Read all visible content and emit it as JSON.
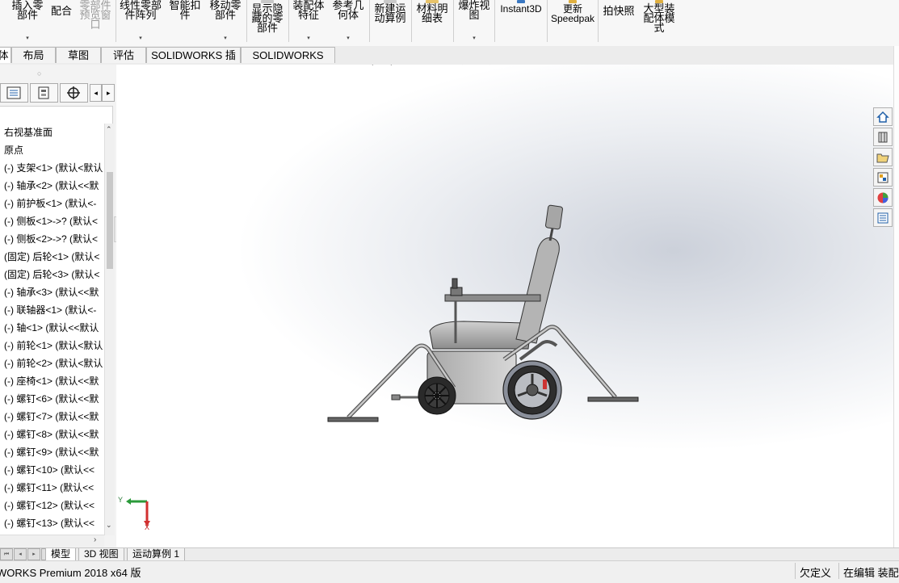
{
  "ribbon": {
    "buttons": [
      {
        "label": "插入零\n部件",
        "dropdown": true,
        "disabled": false
      },
      {
        "label": "配合",
        "dropdown": false,
        "disabled": false
      },
      {
        "label": "零部件\n预览窗\n口",
        "dropdown": false,
        "disabled": true
      },
      {
        "label": "线性零部\n件阵列",
        "dropdown": true,
        "disabled": false
      },
      {
        "label": "智能扣\n件",
        "dropdown": false,
        "disabled": false
      },
      {
        "label": "移动零\n部件",
        "dropdown": true,
        "disabled": false
      },
      {
        "label": "显示隐\n藏的零\n部件",
        "dropdown": false,
        "disabled": false
      },
      {
        "label": "装配体\n特征",
        "dropdown": true,
        "disabled": false
      },
      {
        "label": "参考几\n何体",
        "dropdown": true,
        "disabled": false
      },
      {
        "label": "新建运\n动算例",
        "dropdown": false,
        "disabled": false
      },
      {
        "label": "材料明\n细表",
        "dropdown": false,
        "disabled": false
      },
      {
        "label": "爆炸视\n图",
        "dropdown": true,
        "disabled": false
      },
      {
        "label": "Instant3D",
        "dropdown": false,
        "disabled": false
      },
      {
        "label": "更新\nSpeedpak",
        "dropdown": false,
        "disabled": false
      },
      {
        "label": "拍快照",
        "dropdown": false,
        "disabled": false
      },
      {
        "label": "大型装\n配体模\n式",
        "dropdown": false,
        "disabled": false
      }
    ]
  },
  "command_tabs": [
    {
      "label": "体",
      "active": true
    },
    {
      "label": "布局",
      "active": false
    },
    {
      "label": "草图",
      "active": false
    },
    {
      "label": "评估",
      "active": false
    },
    {
      "label": "SOLIDWORKS 插件",
      "active": false
    },
    {
      "label": "SOLIDWORKS MBD",
      "active": false
    }
  ],
  "feature_tree": {
    "items": [
      "右视基准面",
      "原点",
      "(-) 支架<1> (默认<默认",
      "(-) 轴承<2> (默认<<默",
      "(-) 前护板<1> (默认<-",
      "(-) 侧板<1>->? (默认<",
      "(-) 侧板<2>->? (默认<",
      "(固定) 后轮<1> (默认<",
      "(固定) 后轮<3> (默认<",
      "(-) 轴承<3> (默认<<默",
      "(-) 联轴器<1> (默认<-",
      "(-) 轴<1> (默认<<默认",
      "(-) 前轮<1> (默认<默认",
      "(-) 前轮<2> (默认<默认",
      "(-) 座椅<1> (默认<<默",
      "(-) 螺钉<6> (默认<<默",
      "(-) 螺钉<7> (默认<<默",
      "(-) 螺钉<8> (默认<<默",
      "(-) 螺钉<9> (默认<<默",
      "(-) 螺钉<10> (默认<<",
      "(-) 螺钉<11> (默认<<",
      "(-) 螺钉<12> (默认<<",
      "(-) 螺钉<13> (默认<<"
    ]
  },
  "triad": {
    "y_label": "Y",
    "x_label": "X"
  },
  "bottom_tabs": [
    {
      "label": "模型",
      "active": true
    },
    {
      "label": "3D 视图",
      "active": false
    },
    {
      "label": "运动算例 1",
      "active": false
    }
  ],
  "status": {
    "product": "WORKS Premium 2018 x64 版",
    "state": "欠定义",
    "mode": "在编辑 装配体"
  },
  "colors": {
    "ribbon_bg": "#f7f7f7",
    "viewport_bg": "#ffffff",
    "accent_blue": "#1f5fa8",
    "model_gray": "#9a9a9a"
  },
  "icons": [
    "zoom-to-fit-icon",
    "zoom-area-icon",
    "previous-view-icon",
    "section-view-icon",
    "dynamic-annotation-icon",
    "view-orientation-icon",
    "display-style-icon",
    "hide-show-icon",
    "edit-appearance-icon",
    "apply-scene-icon",
    "view-settings-icon"
  ]
}
